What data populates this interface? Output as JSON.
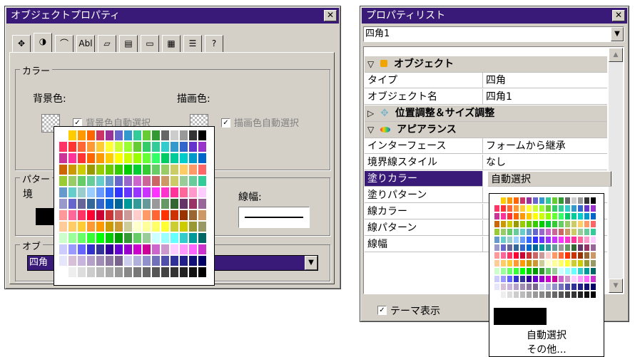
{
  "left_window": {
    "title": "オブジェクトプロパティ",
    "close_symbol": "✕",
    "tabs": [
      {
        "icon": "move-icon",
        "glyph": "✥"
      },
      {
        "icon": "color-icon",
        "glyph": "◑"
      },
      {
        "icon": "appearance-icon",
        "glyph": "⌒"
      },
      {
        "icon": "text-icon",
        "glyph": "Abl"
      },
      {
        "icon": "chart-icon",
        "glyph": "▱"
      },
      {
        "icon": "table-icon",
        "glyph": "▤"
      },
      {
        "icon": "frame-icon",
        "glyph": "▭"
      },
      {
        "icon": "image-icon",
        "glyph": "▦"
      },
      {
        "icon": "list-icon",
        "glyph": "☰"
      },
      {
        "icon": "help-icon",
        "glyph": "?"
      }
    ],
    "color_group": {
      "label": "カラー",
      "bg_label": "背景色:",
      "fg_label": "描画色:",
      "bg_auto_label": "背景色自動選択",
      "fg_auto_label": "描画色自動選択",
      "check_mark": "✓"
    },
    "pattern_group": {
      "label": "パター",
      "sub_label": "境",
      "line_width_label": "線幅:"
    },
    "object_group": {
      "label": "オブ",
      "select_value": "四角"
    },
    "dropdown_arrow": "▼"
  },
  "right_window": {
    "title": "プロパティリスト",
    "close_symbol": "✕",
    "object_select": "四角1",
    "scroll_up": "▲",
    "scroll_down": "▼",
    "sections": {
      "object": {
        "expander": "▽",
        "label": "オブジェクト",
        "icon": "object-icon"
      },
      "position": {
        "expander": "▷",
        "label": "位置調整＆サイズ調整",
        "icon": "move-icon"
      },
      "appearance": {
        "expander": "▽",
        "label": "アピアランス",
        "icon": "appearance-icon"
      }
    },
    "rows": {
      "type": {
        "name": "タイプ",
        "value": "四角"
      },
      "object_name": {
        "name": "オブジェクト名",
        "value": "四角1"
      },
      "interface": {
        "name": "インターフェース",
        "value": "フォームから継承"
      },
      "border_style": {
        "name": "境界線スタイル",
        "value": "なし"
      },
      "fill_color": {
        "name": "塗りカラー",
        "value": "自動選択"
      },
      "fill_pattern": {
        "name": "塗りパターン"
      },
      "line_color": {
        "name": "線カラー"
      },
      "line_pattern": {
        "name": "線パターン"
      },
      "line_width": {
        "name": "線幅"
      }
    },
    "theme_checkbox": {
      "label": "テーマ表示",
      "checked_mark": "✓"
    },
    "palette_menu": {
      "auto_select": "自動選択",
      "other": "その他..."
    }
  },
  "palette_colors": [
    [
      "#ffffff",
      "#ffcc00",
      "#ff9900",
      "#ff6600",
      "#cc3366",
      "#993399",
      "#6666cc",
      "#3399cc",
      "#33cc99",
      "#66cc33",
      "#339933",
      "#666666",
      "#cccccc",
      "#999999",
      "#333333",
      "#000000"
    ],
    [
      "#ff3366",
      "#ff3333",
      "#ff6633",
      "#ff9933",
      "#ffcc33",
      "#ffff33",
      "#ccff33",
      "#99ff33",
      "#66cc33",
      "#33cc66",
      "#33cc99",
      "#33cccc",
      "#3399cc",
      "#3366cc",
      "#6633cc",
      "#9933cc"
    ],
    [
      "#cc3399",
      "#ff3399",
      "#ff3333",
      "#ff6600",
      "#ff9900",
      "#ffcc00",
      "#ffff00",
      "#ccff00",
      "#99ff00",
      "#66ff33",
      "#33ff66",
      "#00cc66",
      "#00cc99",
      "#00cccc",
      "#0099cc",
      "#0066cc"
    ],
    [
      "#cc6600",
      "#cc9900",
      "#cccc00",
      "#999900",
      "#99cc00",
      "#66cc00",
      "#33cc00",
      "#00cc00",
      "#00cc33",
      "#33cc33",
      "#66cc66",
      "#99cc66",
      "#cccc66",
      "#ffcc66",
      "#ff9966",
      "#ff6666"
    ],
    [
      "#99cc33",
      "#99cc66",
      "#66cc66",
      "#66cc99",
      "#66cccc",
      "#6699cc",
      "#6666cc",
      "#9966cc",
      "#cc66cc",
      "#cc6699",
      "#cc6666",
      "#cc9966",
      "#cccc66",
      "#99cc99",
      "#66cc99",
      "#33cc99"
    ],
    [
      "#6699cc",
      "#66cccc",
      "#99cccc",
      "#99ccff",
      "#6699ff",
      "#3366ff",
      "#3333ff",
      "#6633ff",
      "#9933ff",
      "#cc33ff",
      "#ff33ff",
      "#ff33cc",
      "#ff3399",
      "#ff6699",
      "#ff99cc",
      "#ffccff"
    ],
    [
      "#9999cc",
      "#6666cc",
      "#666699",
      "#336699",
      "#3366cc",
      "#0066cc",
      "#006699",
      "#009999",
      "#339999",
      "#669999",
      "#999999",
      "#669966",
      "#336633",
      "#663366",
      "#993366",
      "#996699"
    ],
    [
      "#ff9999",
      "#ff6699",
      "#ff3366",
      "#ff0033",
      "#cc0033",
      "#cc3333",
      "#cc6666",
      "#cc9999",
      "#ffcccc",
      "#ff9966",
      "#ff6633",
      "#ff3300",
      "#cc3300",
      "#993300",
      "#996633",
      "#cc9966"
    ],
    [
      "#ffcc99",
      "#ffcc66",
      "#ffcc33",
      "#ff9933",
      "#ff9900",
      "#cc9900",
      "#cc9933",
      "#cccc99",
      "#ffffcc",
      "#ffff99",
      "#ffff66",
      "#ffff33",
      "#cccc33",
      "#cccc00",
      "#999933",
      "#999966"
    ],
    [
      "#ccffcc",
      "#99ff99",
      "#66ff66",
      "#33ff33",
      "#00ff00",
      "#00cc00",
      "#009900",
      "#339933",
      "#66cc66",
      "#99cc99",
      "#ccffff",
      "#99ffff",
      "#66ffff",
      "#33cccc",
      "#009999",
      "#006666"
    ],
    [
      "#ccccff",
      "#9999ff",
      "#6666ff",
      "#3333cc",
      "#333399",
      "#330099",
      "#6600cc",
      "#9900cc",
      "#cc00cc",
      "#cc0099",
      "#cc66cc",
      "#cc99cc",
      "#ffccff",
      "#ff99ff",
      "#ff66ff",
      "#cc33cc"
    ],
    [
      "#e6e6fa",
      "#d8bfd8",
      "#c8b4dc",
      "#b4a0c8",
      "#a08cb4",
      "#8c78a0",
      "#78648c",
      "#ccccee",
      "#b0b0dd",
      "#9090cc",
      "#7070bb",
      "#5050aa",
      "#303099",
      "#202088",
      "#101077",
      "#000066"
    ],
    [
      "#ffffff",
      "#eeeeee",
      "#dddddd",
      "#cccccc",
      "#bbbbbb",
      "#aaaaaa",
      "#999999",
      "#888888",
      "#777777",
      "#666666",
      "#555555",
      "#444444",
      "#333333",
      "#222222",
      "#111111",
      "#000000"
    ]
  ]
}
